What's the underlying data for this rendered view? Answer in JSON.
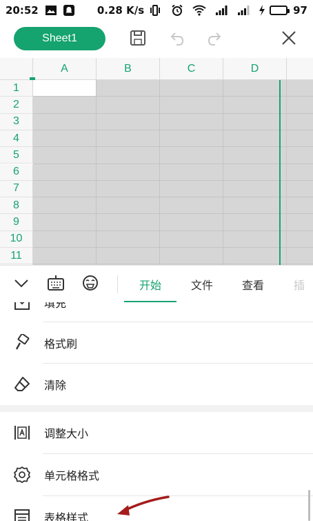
{
  "status_bar": {
    "time": "20:52",
    "net_speed": "0.28 K/s",
    "battery_level": "97",
    "battery_fraction": 0.97,
    "icons": [
      "image-icon",
      "notification-icon",
      "vibrate-icon",
      "alarm-icon",
      "wifi-icon",
      "signal-icon",
      "signal-icon",
      "charging-icon",
      "battery-icon"
    ]
  },
  "toolbar": {
    "sheet_tab": "Sheet1",
    "icons": [
      "save-icon",
      "undo-icon",
      "redo-icon",
      "close-icon"
    ]
  },
  "spreadsheet": {
    "columns": [
      "A",
      "B",
      "C",
      "D"
    ],
    "rows": [
      "1",
      "2",
      "3",
      "4",
      "5",
      "6",
      "7",
      "8",
      "9",
      "10",
      "11"
    ],
    "selected_cell": "A1",
    "accent_color": "#15a36f"
  },
  "tab_bar": {
    "icons": [
      "collapse-chevron-icon",
      "keyboard-icon",
      "emoji-icon"
    ],
    "tabs": [
      {
        "label": "开始",
        "active": true
      },
      {
        "label": "文件",
        "active": false
      },
      {
        "label": "查看",
        "active": false
      },
      {
        "label": "插",
        "active": false
      }
    ]
  },
  "menu": {
    "items": [
      {
        "label": "填充",
        "icon": "fill-icon"
      },
      {
        "label": "格式刷",
        "icon": "format-painter-icon"
      },
      {
        "label": "清除",
        "icon": "eraser-icon"
      },
      {
        "label": "调整大小",
        "icon": "resize-icon"
      },
      {
        "label": "单元格格式",
        "icon": "gear-icon"
      },
      {
        "label": "表格样式",
        "icon": "table-style-icon"
      }
    ]
  },
  "annotation": {
    "arrow_color": "#a51c1c"
  }
}
